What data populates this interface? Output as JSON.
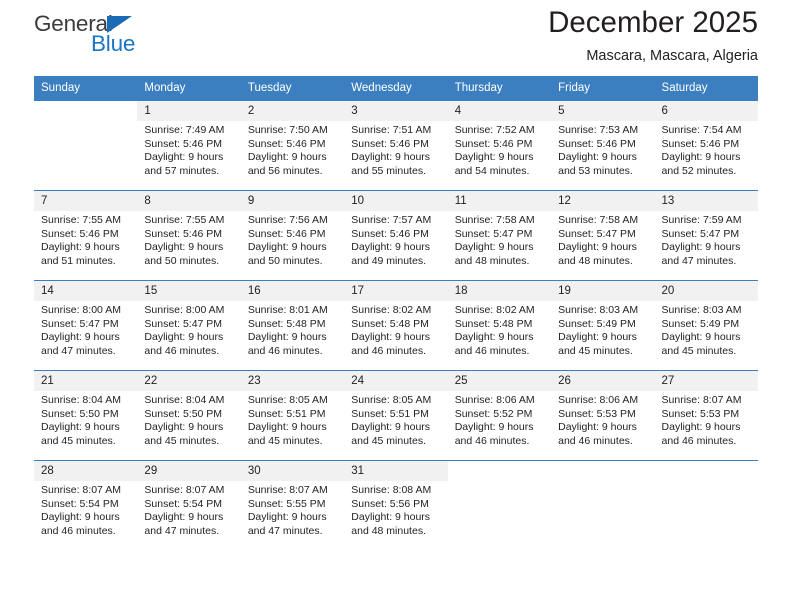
{
  "brand": {
    "name_top": "General",
    "name_bottom": "Blue",
    "triangle_color": "#1a6bb5",
    "blue_color": "#1a76c4"
  },
  "header": {
    "title": "December 2025",
    "location": "Mascara, Mascara, Algeria"
  },
  "theme": {
    "header_blue": "#3c7fc1",
    "daynum_band": "#f1f1f1",
    "text": "#231f20"
  },
  "weekday_headers": [
    "Sunday",
    "Monday",
    "Tuesday",
    "Wednesday",
    "Thursday",
    "Friday",
    "Saturday"
  ],
  "labels": {
    "sunrise_prefix": "Sunrise: ",
    "sunset_prefix": "Sunset: ",
    "daylight_prefix": "Daylight: "
  },
  "weeks": [
    [
      {
        "day": "",
        "sunrise": "",
        "sunset": "",
        "daylight_line1": "",
        "daylight_line2": ""
      },
      {
        "day": "1",
        "sunrise": "Sunrise: 7:49 AM",
        "sunset": "Sunset: 5:46 PM",
        "daylight_line1": "Daylight: 9 hours",
        "daylight_line2": "and 57 minutes."
      },
      {
        "day": "2",
        "sunrise": "Sunrise: 7:50 AM",
        "sunset": "Sunset: 5:46 PM",
        "daylight_line1": "Daylight: 9 hours",
        "daylight_line2": "and 56 minutes."
      },
      {
        "day": "3",
        "sunrise": "Sunrise: 7:51 AM",
        "sunset": "Sunset: 5:46 PM",
        "daylight_line1": "Daylight: 9 hours",
        "daylight_line2": "and 55 minutes."
      },
      {
        "day": "4",
        "sunrise": "Sunrise: 7:52 AM",
        "sunset": "Sunset: 5:46 PM",
        "daylight_line1": "Daylight: 9 hours",
        "daylight_line2": "and 54 minutes."
      },
      {
        "day": "5",
        "sunrise": "Sunrise: 7:53 AM",
        "sunset": "Sunset: 5:46 PM",
        "daylight_line1": "Daylight: 9 hours",
        "daylight_line2": "and 53 minutes."
      },
      {
        "day": "6",
        "sunrise": "Sunrise: 7:54 AM",
        "sunset": "Sunset: 5:46 PM",
        "daylight_line1": "Daylight: 9 hours",
        "daylight_line2": "and 52 minutes."
      }
    ],
    [
      {
        "day": "7",
        "sunrise": "Sunrise: 7:55 AM",
        "sunset": "Sunset: 5:46 PM",
        "daylight_line1": "Daylight: 9 hours",
        "daylight_line2": "and 51 minutes."
      },
      {
        "day": "8",
        "sunrise": "Sunrise: 7:55 AM",
        "sunset": "Sunset: 5:46 PM",
        "daylight_line1": "Daylight: 9 hours",
        "daylight_line2": "and 50 minutes."
      },
      {
        "day": "9",
        "sunrise": "Sunrise: 7:56 AM",
        "sunset": "Sunset: 5:46 PM",
        "daylight_line1": "Daylight: 9 hours",
        "daylight_line2": "and 50 minutes."
      },
      {
        "day": "10",
        "sunrise": "Sunrise: 7:57 AM",
        "sunset": "Sunset: 5:46 PM",
        "daylight_line1": "Daylight: 9 hours",
        "daylight_line2": "and 49 minutes."
      },
      {
        "day": "11",
        "sunrise": "Sunrise: 7:58 AM",
        "sunset": "Sunset: 5:47 PM",
        "daylight_line1": "Daylight: 9 hours",
        "daylight_line2": "and 48 minutes."
      },
      {
        "day": "12",
        "sunrise": "Sunrise: 7:58 AM",
        "sunset": "Sunset: 5:47 PM",
        "daylight_line1": "Daylight: 9 hours",
        "daylight_line2": "and 48 minutes."
      },
      {
        "day": "13",
        "sunrise": "Sunrise: 7:59 AM",
        "sunset": "Sunset: 5:47 PM",
        "daylight_line1": "Daylight: 9 hours",
        "daylight_line2": "and 47 minutes."
      }
    ],
    [
      {
        "day": "14",
        "sunrise": "Sunrise: 8:00 AM",
        "sunset": "Sunset: 5:47 PM",
        "daylight_line1": "Daylight: 9 hours",
        "daylight_line2": "and 47 minutes."
      },
      {
        "day": "15",
        "sunrise": "Sunrise: 8:00 AM",
        "sunset": "Sunset: 5:47 PM",
        "daylight_line1": "Daylight: 9 hours",
        "daylight_line2": "and 46 minutes."
      },
      {
        "day": "16",
        "sunrise": "Sunrise: 8:01 AM",
        "sunset": "Sunset: 5:48 PM",
        "daylight_line1": "Daylight: 9 hours",
        "daylight_line2": "and 46 minutes."
      },
      {
        "day": "17",
        "sunrise": "Sunrise: 8:02 AM",
        "sunset": "Sunset: 5:48 PM",
        "daylight_line1": "Daylight: 9 hours",
        "daylight_line2": "and 46 minutes."
      },
      {
        "day": "18",
        "sunrise": "Sunrise: 8:02 AM",
        "sunset": "Sunset: 5:48 PM",
        "daylight_line1": "Daylight: 9 hours",
        "daylight_line2": "and 46 minutes."
      },
      {
        "day": "19",
        "sunrise": "Sunrise: 8:03 AM",
        "sunset": "Sunset: 5:49 PM",
        "daylight_line1": "Daylight: 9 hours",
        "daylight_line2": "and 45 minutes."
      },
      {
        "day": "20",
        "sunrise": "Sunrise: 8:03 AM",
        "sunset": "Sunset: 5:49 PM",
        "daylight_line1": "Daylight: 9 hours",
        "daylight_line2": "and 45 minutes."
      }
    ],
    [
      {
        "day": "21",
        "sunrise": "Sunrise: 8:04 AM",
        "sunset": "Sunset: 5:50 PM",
        "daylight_line1": "Daylight: 9 hours",
        "daylight_line2": "and 45 minutes."
      },
      {
        "day": "22",
        "sunrise": "Sunrise: 8:04 AM",
        "sunset": "Sunset: 5:50 PM",
        "daylight_line1": "Daylight: 9 hours",
        "daylight_line2": "and 45 minutes."
      },
      {
        "day": "23",
        "sunrise": "Sunrise: 8:05 AM",
        "sunset": "Sunset: 5:51 PM",
        "daylight_line1": "Daylight: 9 hours",
        "daylight_line2": "and 45 minutes."
      },
      {
        "day": "24",
        "sunrise": "Sunrise: 8:05 AM",
        "sunset": "Sunset: 5:51 PM",
        "daylight_line1": "Daylight: 9 hours",
        "daylight_line2": "and 45 minutes."
      },
      {
        "day": "25",
        "sunrise": "Sunrise: 8:06 AM",
        "sunset": "Sunset: 5:52 PM",
        "daylight_line1": "Daylight: 9 hours",
        "daylight_line2": "and 46 minutes."
      },
      {
        "day": "26",
        "sunrise": "Sunrise: 8:06 AM",
        "sunset": "Sunset: 5:53 PM",
        "daylight_line1": "Daylight: 9 hours",
        "daylight_line2": "and 46 minutes."
      },
      {
        "day": "27",
        "sunrise": "Sunrise: 8:07 AM",
        "sunset": "Sunset: 5:53 PM",
        "daylight_line1": "Daylight: 9 hours",
        "daylight_line2": "and 46 minutes."
      }
    ],
    [
      {
        "day": "28",
        "sunrise": "Sunrise: 8:07 AM",
        "sunset": "Sunset: 5:54 PM",
        "daylight_line1": "Daylight: 9 hours",
        "daylight_line2": "and 46 minutes."
      },
      {
        "day": "29",
        "sunrise": "Sunrise: 8:07 AM",
        "sunset": "Sunset: 5:54 PM",
        "daylight_line1": "Daylight: 9 hours",
        "daylight_line2": "and 47 minutes."
      },
      {
        "day": "30",
        "sunrise": "Sunrise: 8:07 AM",
        "sunset": "Sunset: 5:55 PM",
        "daylight_line1": "Daylight: 9 hours",
        "daylight_line2": "and 47 minutes."
      },
      {
        "day": "31",
        "sunrise": "Sunrise: 8:08 AM",
        "sunset": "Sunset: 5:56 PM",
        "daylight_line1": "Daylight: 9 hours",
        "daylight_line2": "and 48 minutes."
      },
      {
        "day": "",
        "sunrise": "",
        "sunset": "",
        "daylight_line1": "",
        "daylight_line2": ""
      },
      {
        "day": "",
        "sunrise": "",
        "sunset": "",
        "daylight_line1": "",
        "daylight_line2": ""
      },
      {
        "day": "",
        "sunrise": "",
        "sunset": "",
        "daylight_line1": "",
        "daylight_line2": ""
      }
    ]
  ]
}
